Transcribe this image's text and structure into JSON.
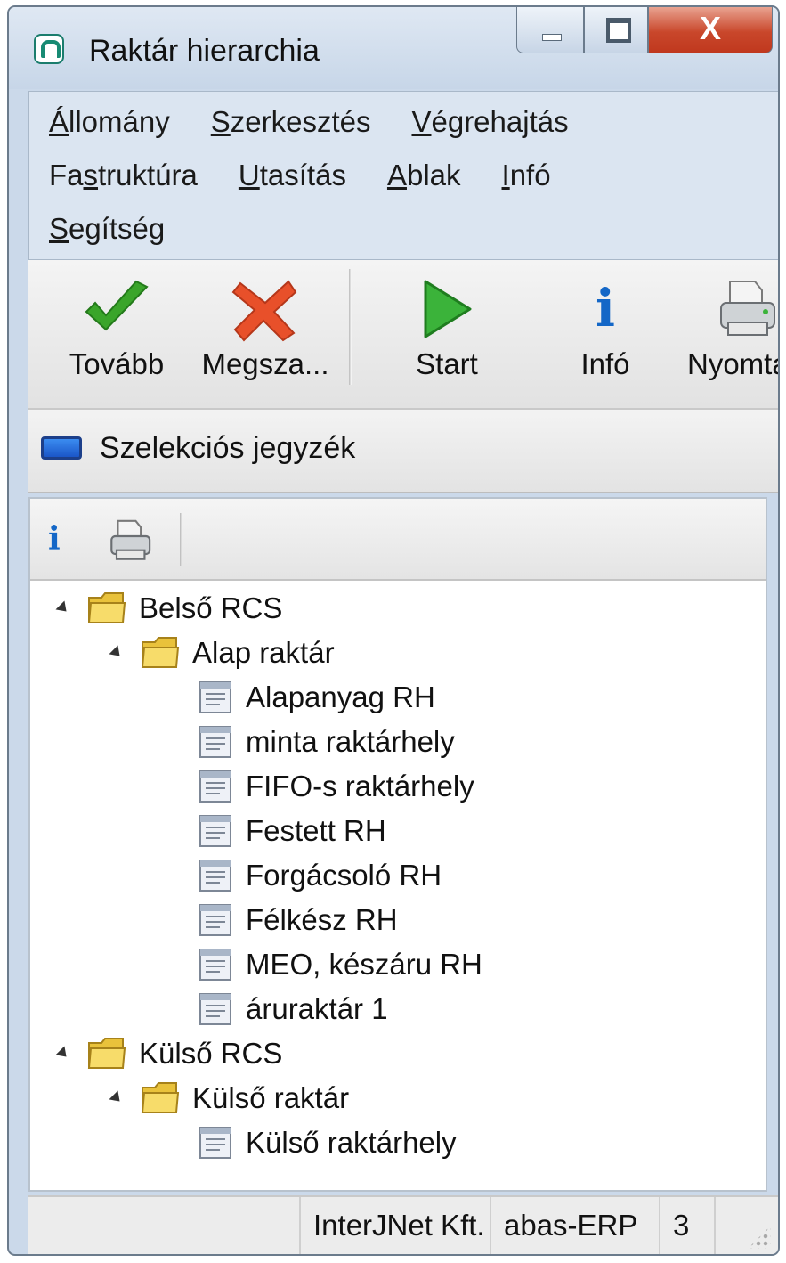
{
  "window": {
    "title": "Raktár hierarchia",
    "close_glyph": "X"
  },
  "menu": {
    "rows": [
      [
        {
          "pre": "",
          "ul": "Á",
          "post": "llomány"
        },
        {
          "pre": "",
          "ul": "S",
          "post": "zerkesztés"
        },
        {
          "pre": "",
          "ul": "V",
          "post": "égrehajtás"
        }
      ],
      [
        {
          "pre": "Fa",
          "ul": "s",
          "post": "truktúra"
        },
        {
          "pre": "",
          "ul": "U",
          "post": "tasítás"
        },
        {
          "pre": "",
          "ul": "A",
          "post": "blak"
        },
        {
          "pre": "",
          "ul": "I",
          "post": "nfó"
        }
      ],
      [
        {
          "pre": "",
          "ul": "S",
          "post": "egítség"
        }
      ]
    ]
  },
  "toolbar": {
    "tovabb": "Tovább",
    "megszakit": "Megsza...",
    "start": "Start",
    "info": "Infó",
    "nyomtat": "Nyomta",
    "info_glyph": "i"
  },
  "selection": {
    "label": "Szelekciós jegyzék"
  },
  "panel_toolbar": {
    "info_glyph": "i"
  },
  "tree": {
    "belso_rcs": "Belső RCS",
    "alap_raktar": "Alap raktár",
    "alap_items": [
      "Alapanyag RH",
      "minta raktárhely",
      "FIFO-s raktárhely",
      "Festett  RH",
      "Forgácsoló RH",
      "Félkész RH",
      "MEO, készáru RH",
      "áruraktár 1"
    ],
    "kulso_rcs": "Külső  RCS",
    "kulso_raktar": "Külső raktár",
    "kulso_items": [
      "Külső raktárhely"
    ]
  },
  "statusbar": {
    "company": "InterJNet Kft.",
    "product": "abas-ERP",
    "count": "3"
  },
  "colors": {
    "titlebar": "#cbd9ea",
    "close": "#c9472b",
    "check": "#3aa52a",
    "cross": "#e8502a",
    "start": "#3bb33a",
    "info": "#1467c7",
    "folder": "#e9c23b"
  }
}
